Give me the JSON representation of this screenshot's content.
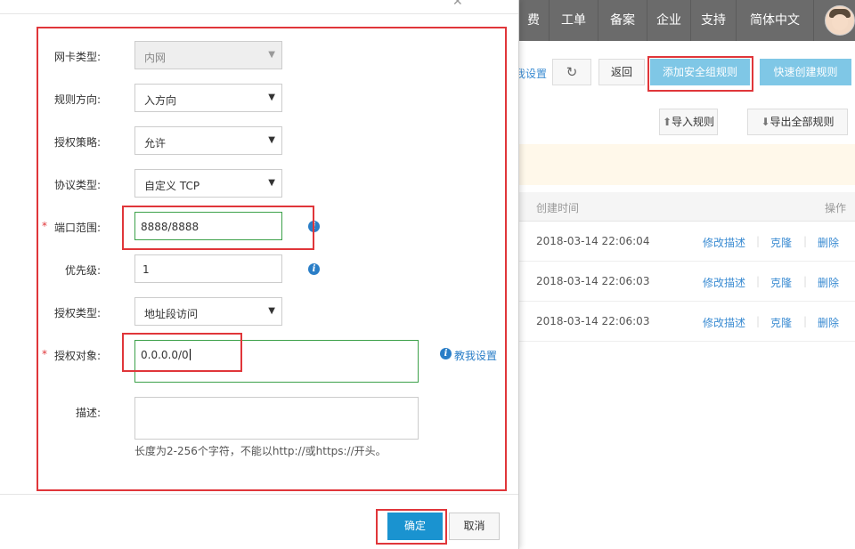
{
  "topnav": {
    "items": [
      "费用",
      "工单",
      "备案",
      "企业",
      "支持",
      "简体中文"
    ]
  },
  "toolbar": {
    "teach_link": "教我设置",
    "refresh_icon": "refresh-icon",
    "back": "返回",
    "add_rule": "添加安全组规则",
    "quick_create": "快速创建规则"
  },
  "rowbar": {
    "import": "导入规则",
    "export": "导出全部规则"
  },
  "table": {
    "col_created": "创建时间",
    "col_actions": "操作",
    "rows": [
      {
        "time": "2018-03-14 22:06:04",
        "edit": "修改描述",
        "clone": "克隆",
        "delete": "删除"
      },
      {
        "time": "2018-03-14 22:06:03",
        "edit": "修改描述",
        "clone": "克隆",
        "delete": "删除"
      },
      {
        "time": "2018-03-14 22:06:03",
        "edit": "修改描述",
        "clone": "克隆",
        "delete": "删除"
      }
    ]
  },
  "dialog": {
    "nic_type": {
      "label": "网卡类型:",
      "value": "内网"
    },
    "direction": {
      "label": "规则方向:",
      "value": "入方向"
    },
    "policy": {
      "label": "授权策略:",
      "value": "允许"
    },
    "protocol": {
      "label": "协议类型:",
      "value": "自定义 TCP"
    },
    "port": {
      "label": "端口范围:",
      "value": "8888/8888"
    },
    "priority": {
      "label": "优先级:",
      "value": "1"
    },
    "auth_type": {
      "label": "授权类型:",
      "value": "地址段访问"
    },
    "auth_object": {
      "label": "授权对象:",
      "value": "0.0.0.0/0"
    },
    "teach_link": "教我设置",
    "description": {
      "label": "描述:",
      "value": ""
    },
    "hint": "长度为2-256个字符，不能以http://或https://开头。",
    "ok": "确定",
    "cancel": "取消"
  },
  "colors": {
    "primary": "#1a93d0",
    "highlight_border": "#e0363a",
    "valid_border": "#3da14a",
    "link": "#2a7ec7"
  }
}
